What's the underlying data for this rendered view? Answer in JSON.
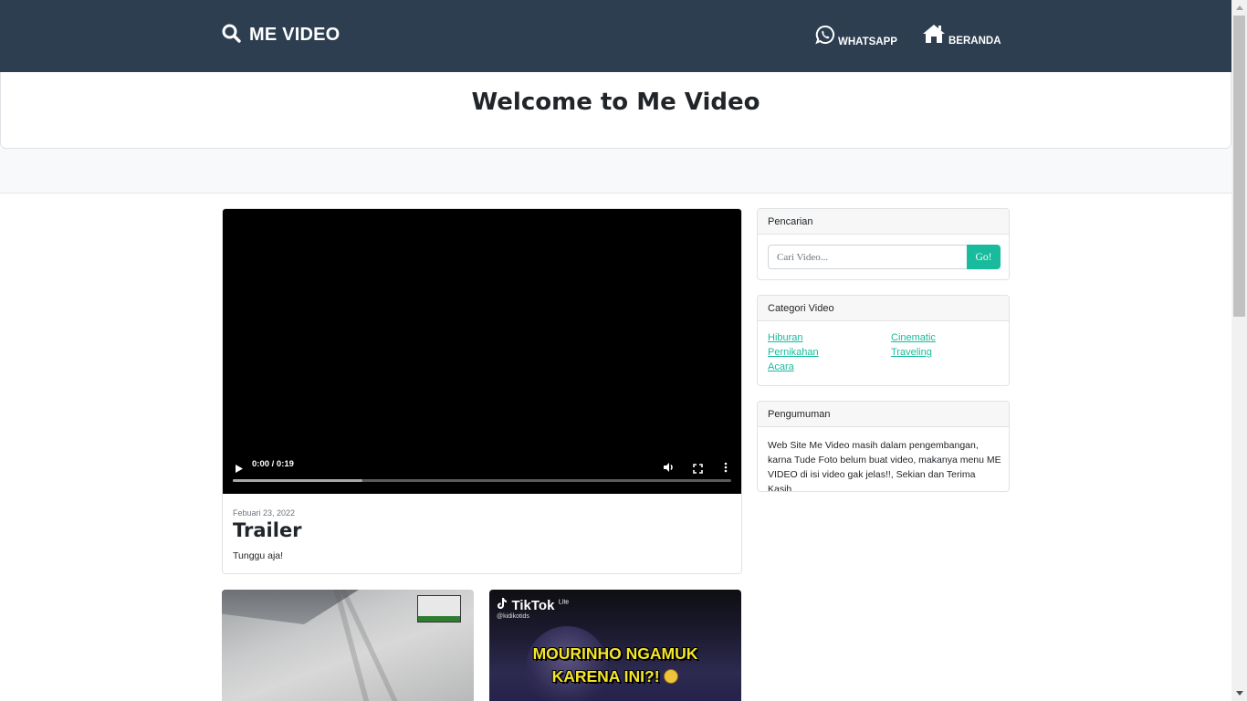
{
  "navbar": {
    "brand": "ME VIDEO",
    "links": [
      {
        "label": "WHATSAPP",
        "icon": "whatsapp-icon"
      },
      {
        "label": "BERANDA",
        "icon": "home-icon"
      }
    ],
    "background": "#2c3e50"
  },
  "welcome": {
    "title": "Welcome to Me Video"
  },
  "main_post": {
    "video": {
      "time": "0:00 / 0:19",
      "buffered_fraction": 0.26
    },
    "date": "Febuari 23, 2022",
    "title": "Trailer",
    "description": "Tunggu aja!"
  },
  "thumbnails": [
    {
      "label": "cctv-video-thumbnail"
    },
    {
      "label": "tiktok-video-thumbnail",
      "brand": "TikTok",
      "brand_suffix": "Lite",
      "user": "@kidikotids",
      "caption_line1": "MOURINHO NGAMUK",
      "caption_line2": "KARENA INI?!"
    }
  ],
  "sidebar": {
    "search": {
      "title": "Pencarian",
      "placeholder": "Cari Video...",
      "button": "Go!"
    },
    "categories": {
      "title": "Categori Video",
      "items": [
        "Hiburan",
        "Cinematic",
        "Pernikahan",
        "Traveling",
        "Acara"
      ]
    },
    "announcement": {
      "title": "Pengumuman",
      "text": "Web Site Me Video masih dalam pengembangan, karna Tude Foto belum buat video, makanya menu ME VIDEO di isi video gak jelas!!, Sekian dan Terima Kasih"
    }
  },
  "colors": {
    "accent": "#18bc9c",
    "navbar": "#2c3e50"
  }
}
